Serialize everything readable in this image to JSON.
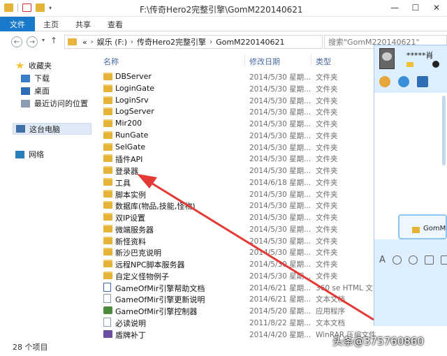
{
  "window": {
    "title": "F:\\传奇Hero2完整引擎\\GomM220140621",
    "minimize_glyph": "—",
    "maximize_glyph": "☐",
    "close_glyph": "✕"
  },
  "ribbon": {
    "tabs": [
      "文件",
      "主页",
      "共享",
      "查看"
    ]
  },
  "address": {
    "overflow": "«",
    "crumbs": [
      "娱乐 (F:)",
      "传奇Hero2完整引擎",
      "GomM220140621"
    ],
    "search_placeholder": "搜索\"GomM220140621\""
  },
  "nav": {
    "favorites": "收藏夹",
    "downloads": "下载",
    "desktop": "桌面",
    "recent": "最近访问的位置",
    "this_pc": "这台电脑",
    "network": "网络"
  },
  "columns": {
    "name": "名称",
    "date": "修改日期",
    "type": "类型"
  },
  "files": [
    {
      "name": "DBServer",
      "date": "2014/5/30 星期...",
      "type": "文件夹",
      "icon": "folder"
    },
    {
      "name": "LoginGate",
      "date": "2014/5/30 星期...",
      "type": "文件夹",
      "icon": "folder"
    },
    {
      "name": "LoginSrv",
      "date": "2014/5/30 星期...",
      "type": "文件夹",
      "icon": "folder"
    },
    {
      "name": "LogServer",
      "date": "2014/5/30 星期...",
      "type": "文件夹",
      "icon": "folder"
    },
    {
      "name": "Mir200",
      "date": "2014/5/30 星期...",
      "type": "文件夹",
      "icon": "folder"
    },
    {
      "name": "RunGate",
      "date": "2014/5/30 星期...",
      "type": "文件夹",
      "icon": "folder"
    },
    {
      "name": "SelGate",
      "date": "2014/5/30 星期...",
      "type": "文件夹",
      "icon": "folder"
    },
    {
      "name": "插件API",
      "date": "2014/5/30 星期...",
      "type": "文件夹",
      "icon": "folder"
    },
    {
      "name": "登录器",
      "date": "2014/5/30 星期...",
      "type": "文件夹",
      "icon": "folder"
    },
    {
      "name": "工具",
      "date": "2014/6/18 星期...",
      "type": "文件夹",
      "icon": "folder"
    },
    {
      "name": "脚本实例",
      "date": "2014/5/30 星期...",
      "type": "文件夹",
      "icon": "folder"
    },
    {
      "name": "数据库(物品,技能,怪物)",
      "date": "2014/5/30 星期...",
      "type": "文件夹",
      "icon": "folder"
    },
    {
      "name": "双IP设置",
      "date": "2014/5/30 星期...",
      "type": "文件夹",
      "icon": "folder"
    },
    {
      "name": "微端服务器",
      "date": "2014/5/30 星期...",
      "type": "文件夹",
      "icon": "folder"
    },
    {
      "name": "新怪资料",
      "date": "2014/5/30 星期...",
      "type": "文件夹",
      "icon": "folder"
    },
    {
      "name": "新沙巴克说明",
      "date": "2014/5/30 星期...",
      "type": "文件夹",
      "icon": "folder"
    },
    {
      "name": "远程NPC脚本服务器",
      "date": "2014/5/30 星期...",
      "type": "文件夹",
      "icon": "folder"
    },
    {
      "name": "自定义怪物例子",
      "date": "2014/5/30 星期...",
      "type": "文件夹",
      "icon": "folder"
    },
    {
      "name": "GameOfMir引擎帮助文档",
      "date": "2014/6/21 星期...",
      "type": "360 se HTML 文...",
      "icon": "htm"
    },
    {
      "name": "GameOfMir引擎更新说明",
      "date": "2014/6/21 星期...",
      "type": "文本文档",
      "icon": "doc"
    },
    {
      "name": "GameOfMir引擎控制器",
      "date": "2014/5/20 星期...",
      "type": "应用程序",
      "icon": "exe"
    },
    {
      "name": "必读说明",
      "date": "2011/8/22 星期...",
      "type": "文本文档",
      "icon": "doc"
    },
    {
      "name": "盾牌补丁",
      "date": "2014/4/20 星期...",
      "type": "WinRAR 压缩文件",
      "icon": "bat"
    }
  ],
  "status": {
    "item_count": "28 个项目"
  },
  "chat": {
    "username": "*****肖",
    "file_label": "GomM"
  },
  "watermark": "头条@375760860",
  "colors": {
    "accent": "#1979ca",
    "folder": "#e6b339",
    "arrow": "#e53935",
    "chat_bg": "#ddeeff"
  }
}
